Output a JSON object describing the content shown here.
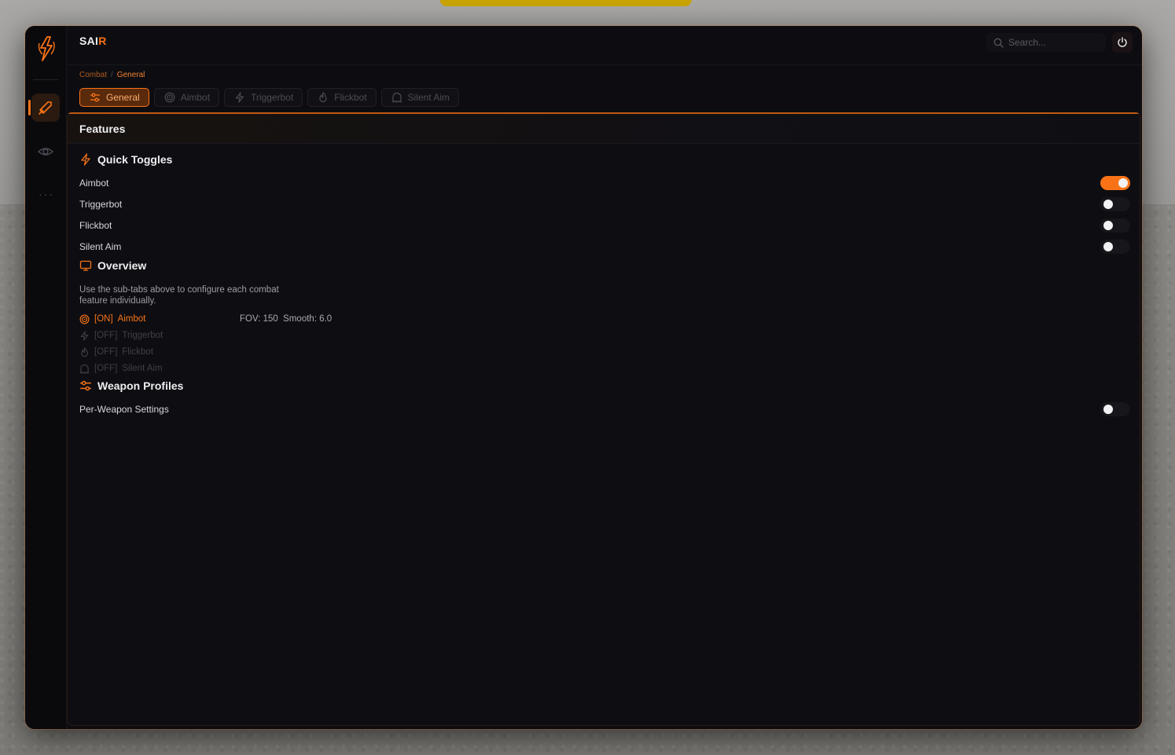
{
  "brand": {
    "name_main": "SAI",
    "name_accent": "R"
  },
  "search": {
    "placeholder": "Search..."
  },
  "breadcrumb": {
    "parent": "Combat",
    "separator": "/",
    "current": "General"
  },
  "tabs": [
    {
      "label": "General",
      "icon": "sliders-icon",
      "active": true
    },
    {
      "label": "Aimbot",
      "icon": "target-icon",
      "active": false
    },
    {
      "label": "Triggerbot",
      "icon": "zap-icon",
      "active": false
    },
    {
      "label": "Flickbot",
      "icon": "flame-icon",
      "active": false
    },
    {
      "label": "Silent Aim",
      "icon": "ghost-icon",
      "active": false
    }
  ],
  "panel": {
    "title": "Features"
  },
  "quick_toggles": {
    "title": "Quick Toggles",
    "items": [
      {
        "label": "Aimbot",
        "on": true
      },
      {
        "label": "Triggerbot",
        "on": false
      },
      {
        "label": "Flickbot",
        "on": false
      },
      {
        "label": "Silent Aim",
        "on": false
      }
    ]
  },
  "overview": {
    "title": "Overview",
    "description": "Use the sub-tabs above to configure each combat feature individually.",
    "statuses": [
      {
        "state": "[ON]",
        "name": "Aimbot",
        "info": "FOV: 150  Smooth: 6.0",
        "on": true
      },
      {
        "state": "[OFF]",
        "name": "Triggerbot",
        "info": "",
        "on": false
      },
      {
        "state": "[OFF]",
        "name": "Flickbot",
        "info": "",
        "on": false
      },
      {
        "state": "[OFF]",
        "name": "Silent Aim",
        "info": "",
        "on": false
      }
    ]
  },
  "weapon_profiles": {
    "title": "Weapon Profiles",
    "items": [
      {
        "label": "Per-Weapon Settings",
        "on": false
      }
    ]
  },
  "colors": {
    "accent": "#f97316",
    "background": "#0d0d11"
  }
}
